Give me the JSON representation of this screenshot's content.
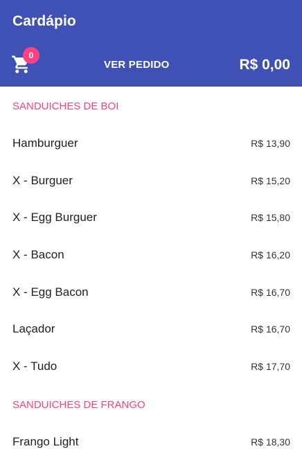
{
  "header": {
    "title": "Cardápio",
    "cart_icon": "shopping-cart-icon",
    "cart_count": "0",
    "view_order_label": "VER PEDIDO",
    "total": "R$ 0,00",
    "colors": {
      "primary": "#3f51b5",
      "accent": "#ff4081"
    }
  },
  "sections": [
    {
      "title": "SANDUICHES DE BOI",
      "items": [
        {
          "name": "Hamburguer",
          "price": "R$ 13,90"
        },
        {
          "name": "X - Burguer",
          "price": "R$ 15,20"
        },
        {
          "name": "X - Egg Burguer",
          "price": "R$ 15,80"
        },
        {
          "name": "X - Bacon",
          "price": "R$ 16,20"
        },
        {
          "name": "X - Egg Bacon",
          "price": "R$ 16,70"
        },
        {
          "name": "Laçador",
          "price": "R$ 16,70"
        },
        {
          "name": "X - Tudo",
          "price": "R$ 17,70"
        }
      ]
    },
    {
      "title": "SANDUICHES DE FRANGO",
      "items": [
        {
          "name": "Frango Light",
          "price": "R$ 18,30"
        }
      ]
    }
  ]
}
